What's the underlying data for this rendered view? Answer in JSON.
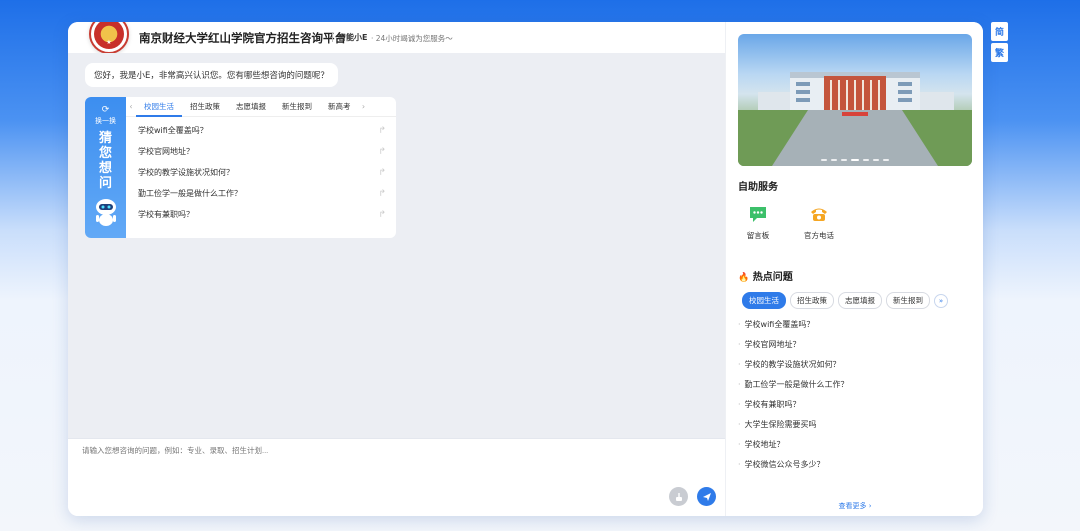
{
  "lang": {
    "simplified": "简",
    "traditional": "繁"
  },
  "header": {
    "title": "南京财经大学红山学院官方招生咨询平台",
    "bot_name": "智能小E",
    "slogan": "· 24小时竭诚为您服务～"
  },
  "chat": {
    "greeting": "您好，我是小E，非常高兴认识您。您有哪些想咨询的问题呢？",
    "guess": {
      "refresh_label": "换一换",
      "title": "猜您想问",
      "tabs": [
        "校园生活",
        "招生政策",
        "志愿填报",
        "新生报到",
        "新高考"
      ],
      "active_tab": "校园生活",
      "questions": [
        "学校wifi全覆盖吗？",
        "学校官网地址？",
        "学校的教学设施状况如何？",
        "勤工俭学一般是做什么工作？",
        "学校有兼职吗？"
      ]
    }
  },
  "input": {
    "placeholder": "请输入您想咨询的问题，例如：专业、录取、招生计划..."
  },
  "sidebar": {
    "self_service_title": "自助服务",
    "services": [
      {
        "label": "留言板",
        "icon": "message-board-icon",
        "color": "#3cc06a"
      },
      {
        "label": "官方电话",
        "icon": "phone-icon",
        "color": "#f5a623"
      }
    ],
    "hot_title": "热点问题",
    "hot_tabs": [
      "校园生活",
      "招生政策",
      "志愿填报",
      "新生报到"
    ],
    "hot_active_tab": "校园生活",
    "hot_questions": [
      "学校wifi全覆盖吗？",
      "学校官网地址？",
      "学校的教学设施状况如何？",
      "勤工俭学一般是做什么工作？",
      "学校有兼职吗？",
      "大学生保险需要买吗",
      "学校地址？",
      "学校微信公众号多少？"
    ],
    "see_more": "查看更多 ›"
  },
  "colors": {
    "accent": "#2f7be9",
    "brand_red": "#c83c32"
  }
}
